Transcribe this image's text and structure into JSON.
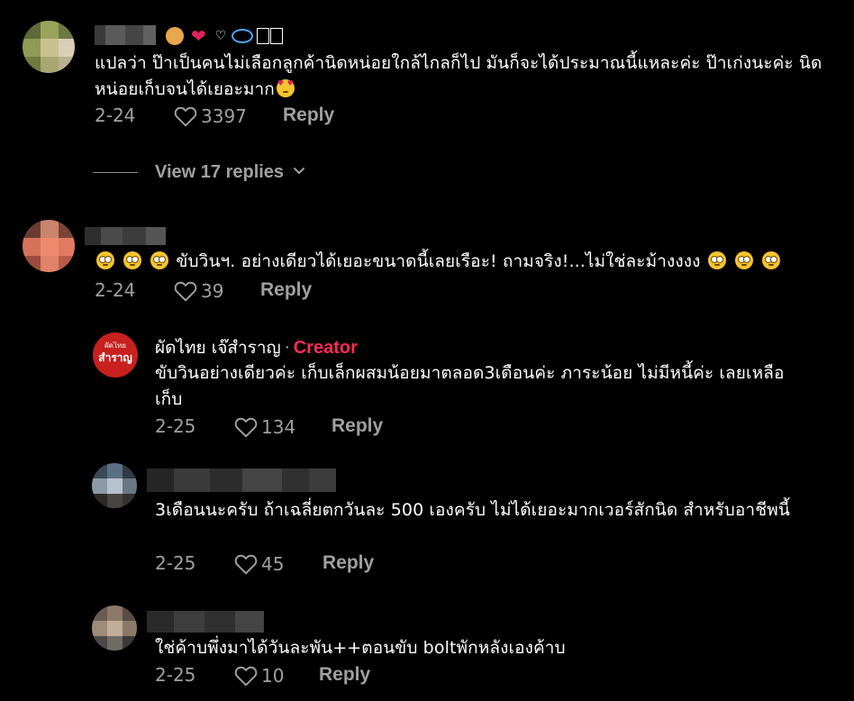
{
  "comments": [
    {
      "text": "แปลว่า ป๊าเป็นคนไม่เลือกลูกค้านิดหน่อยใกล้ไกลก็ไป มันก็จะได้ประมาณนี้แหละค่ะ ป๊าเก่งนะค่ะ นิดหน่อยเก็บจนได้เยอะมาก",
      "date": "2-24",
      "likes": "3397",
      "reply_label": "Reply",
      "view_replies_label": "View 17 replies"
    },
    {
      "text": "ขับวินฯ. อย่างเดียวได้เยอะขนาดนี้เลยเรือะ! ถามจริง!...ไม่ใช่ละม้างงงง",
      "date": "2-24",
      "likes": "39",
      "reply_label": "Reply"
    }
  ],
  "replies": [
    {
      "author": "ผัดไทย เจ๊สำราญ",
      "creator_label": "Creator",
      "text": "ขับวินอย่างเดียวค่ะ เก็บเล็กผสมน้อยมาตลอด3เดือนค่ะ ภาระน้อย ไม่มีหนี้ค่ะ เลยเหลือเก็บ",
      "date": "2-25",
      "likes": "134",
      "reply_label": "Reply",
      "avatar_text_top": "ผัดไทย",
      "avatar_text_mid": "สำราญ"
    },
    {
      "text": "3เดือนนะครับ ถ้าเฉลี่ยตกวันละ 500 เองครับ ไม่ได้เยอะมากเวอร์สักนิด สำหรับอาชีพนี้",
      "date": "2-25",
      "likes": "45",
      "reply_label": "Reply"
    },
    {
      "text": "ใช่ค้าบพึ่งมาได้วันละพัน++ตอนขับ boltพักหลังเองค้าบ",
      "date": "2-25",
      "likes": "10",
      "reply_label": "Reply"
    }
  ],
  "colors": {
    "background": "#000000",
    "text": "#ffffff",
    "muted": "#a0a0a0",
    "creator_accent": "#fe2c55",
    "heart": "#e0245e"
  },
  "icons": {
    "like": "heart-outline-icon",
    "chevron": "chevron-down-icon",
    "emoji_smiling_hearts": "smiling-face-with-hearts-icon",
    "emoji_rolling_eyes": "face-with-rolling-eyes-icon"
  }
}
